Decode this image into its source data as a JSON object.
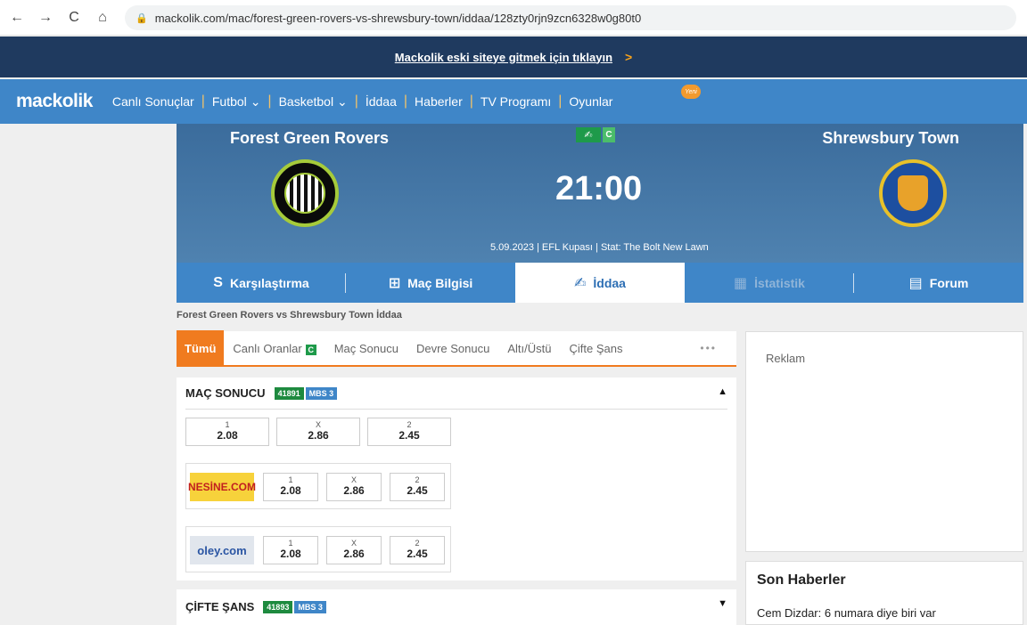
{
  "browser": {
    "url": "mackolik.com/mac/forest-green-rovers-vs-shrewsbury-town/iddaa/128zty0rjn9zcn6328w0g80t0",
    "back": "←",
    "forward": "→",
    "reload": "C",
    "home": "⌂"
  },
  "banner": {
    "text": "Mackolik eski siteye gitmek için tıklayın",
    "chevron": ">"
  },
  "nav": {
    "logo": "mackolik",
    "items": [
      "Canlı Sonuçlar",
      "Futbol",
      "Basketbol",
      "İddaa",
      "Haberler",
      "TV Programı",
      "Oyunlar"
    ],
    "dropdown": "⌄",
    "new_badge": "Yeni"
  },
  "match": {
    "home": "Forest Green Rovers",
    "away": "Shrewsbury Town",
    "time": "21:00",
    "live_icon": "✍",
    "live_c": "C",
    "info": "5.09.2023 | EFL Kupası | Stat: The Bolt New Lawn"
  },
  "tabs": [
    {
      "label": "Karşılaştırma",
      "icon": "S"
    },
    {
      "label": "Maç Bilgisi",
      "icon": "⊞"
    },
    {
      "label": "İddaa",
      "icon": "✍"
    },
    {
      "label": "İstatistik",
      "icon": "▦"
    },
    {
      "label": "Forum",
      "icon": "▤"
    }
  ],
  "breadcrumb": "Forest Green Rovers vs Shrewsbury Town İddaa",
  "filters": [
    "Tümü",
    "Canlı Oranlar",
    "Maç Sonucu",
    "Devre Sonucu",
    "Altı/Üstü",
    "Çifte Şans"
  ],
  "filter_c": "C",
  "more": "•••",
  "markets": [
    {
      "title": "MAÇ SONUCU",
      "code": "41891",
      "mbs": "MBS 3",
      "caret": "▲",
      "main": [
        {
          "l": "1",
          "v": "2.08"
        },
        {
          "l": "X",
          "v": "2.86"
        },
        {
          "l": "2",
          "v": "2.45"
        }
      ],
      "books": [
        {
          "name": "NESİNE.COM",
          "odds": [
            {
              "l": "1",
              "v": "2.08"
            },
            {
              "l": "X",
              "v": "2.86"
            },
            {
              "l": "2",
              "v": "2.45"
            }
          ]
        },
        {
          "name": "oley.com",
          "odds": [
            {
              "l": "1",
              "v": "2.08"
            },
            {
              "l": "X",
              "v": "2.86"
            },
            {
              "l": "2",
              "v": "2.45"
            }
          ]
        }
      ]
    },
    {
      "title": "ÇİFTE ŞANS",
      "code": "41893",
      "mbs": "MBS 3",
      "caret": "▼"
    }
  ],
  "sidebar": {
    "ad_label": "Reklam",
    "news_title": "Son Haberler",
    "news_item": "Cem Dizdar: 6 numara diye biri var"
  }
}
